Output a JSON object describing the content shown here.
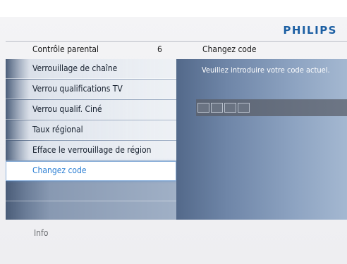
{
  "brand": "PHILIPS",
  "header": {
    "left_title": "Contrôle parental",
    "count": "6",
    "right_title": "Changez code"
  },
  "menu": {
    "items": [
      {
        "label": "Verrouillage de chaîne"
      },
      {
        "label": "Verrou qualifications TV"
      },
      {
        "label": "Verrou qualif. Ciné"
      },
      {
        "label": "Taux régional"
      },
      {
        "label": "Efface le verrouillage de région"
      },
      {
        "label": "Changez code",
        "selected": true
      }
    ]
  },
  "right": {
    "message": "Veuillez introduire votre code actuel.",
    "code_boxes": 4
  },
  "footer": {
    "info": "Info"
  },
  "colors": {
    "brand": "#1c5fa3",
    "selected_text": "#2a7ed3"
  }
}
